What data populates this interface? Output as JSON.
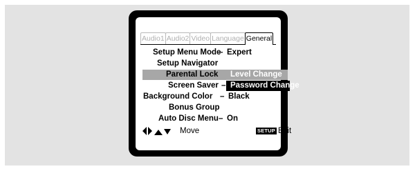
{
  "tabs": [
    "Audio1",
    "Audio2",
    "Video",
    "Language",
    "General"
  ],
  "active_tab_index": 4,
  "menu": {
    "rows": [
      {
        "key": "Setup Menu Mode",
        "sep": "–",
        "value": "Expert"
      },
      {
        "key": "Setup Navigator",
        "sep": "",
        "value": ""
      },
      {
        "key": "Parental Lock",
        "sep": "",
        "value": ""
      },
      {
        "key": "Screen Saver",
        "sep": "–",
        "value": ""
      },
      {
        "key": "Background Color",
        "sep": "–",
        "value": "Black"
      },
      {
        "key": "Bonus Group",
        "sep": "",
        "value": ""
      },
      {
        "key": "Auto Disc Menu",
        "sep": "–",
        "value": "On"
      }
    ],
    "highlighted_row": "Parental Lock"
  },
  "submenu": {
    "items": [
      "Level Change",
      "Password Change"
    ],
    "selected": "Password Change"
  },
  "footer": {
    "move_label": "Move",
    "setup_badge": "SETUP",
    "exit_label": "Exit"
  },
  "colors": {
    "background_panel": "#e3e3e3",
    "tv_frame": "#000000",
    "highlight": "#a7a7a7",
    "selected_bg": "#000000"
  },
  "icons": [
    "arrow-left-icon",
    "arrow-right-icon",
    "arrow-up-icon",
    "arrow-down-icon"
  ]
}
